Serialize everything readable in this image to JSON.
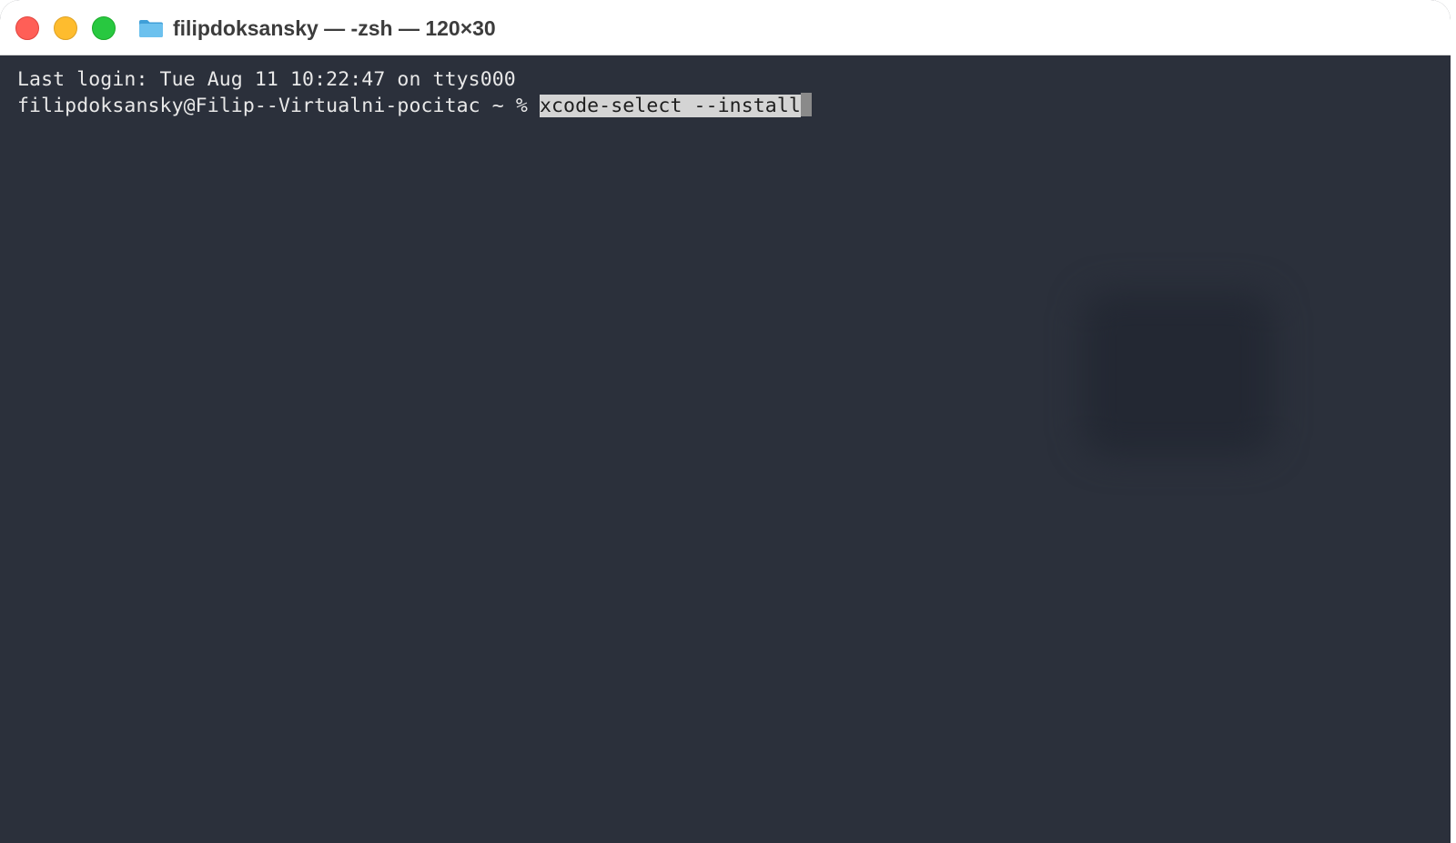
{
  "window": {
    "title": "filipdoksansky — -zsh — 120×30"
  },
  "terminal": {
    "last_login_line": "Last login: Tue Aug 11 10:22:47 on ttys000",
    "prompt": "filipdoksansky@Filip--Virtualni-pocitac ~ % ",
    "command": "xcode-select --install"
  },
  "colors": {
    "terminal_background": "#2b303b",
    "titlebar_background": "#ffffff",
    "close": "#ff5f57",
    "minimize": "#febc2e",
    "zoom": "#28c840",
    "folder": "#5ab4e6"
  },
  "icons": {
    "window_icon": "folder-icon"
  }
}
